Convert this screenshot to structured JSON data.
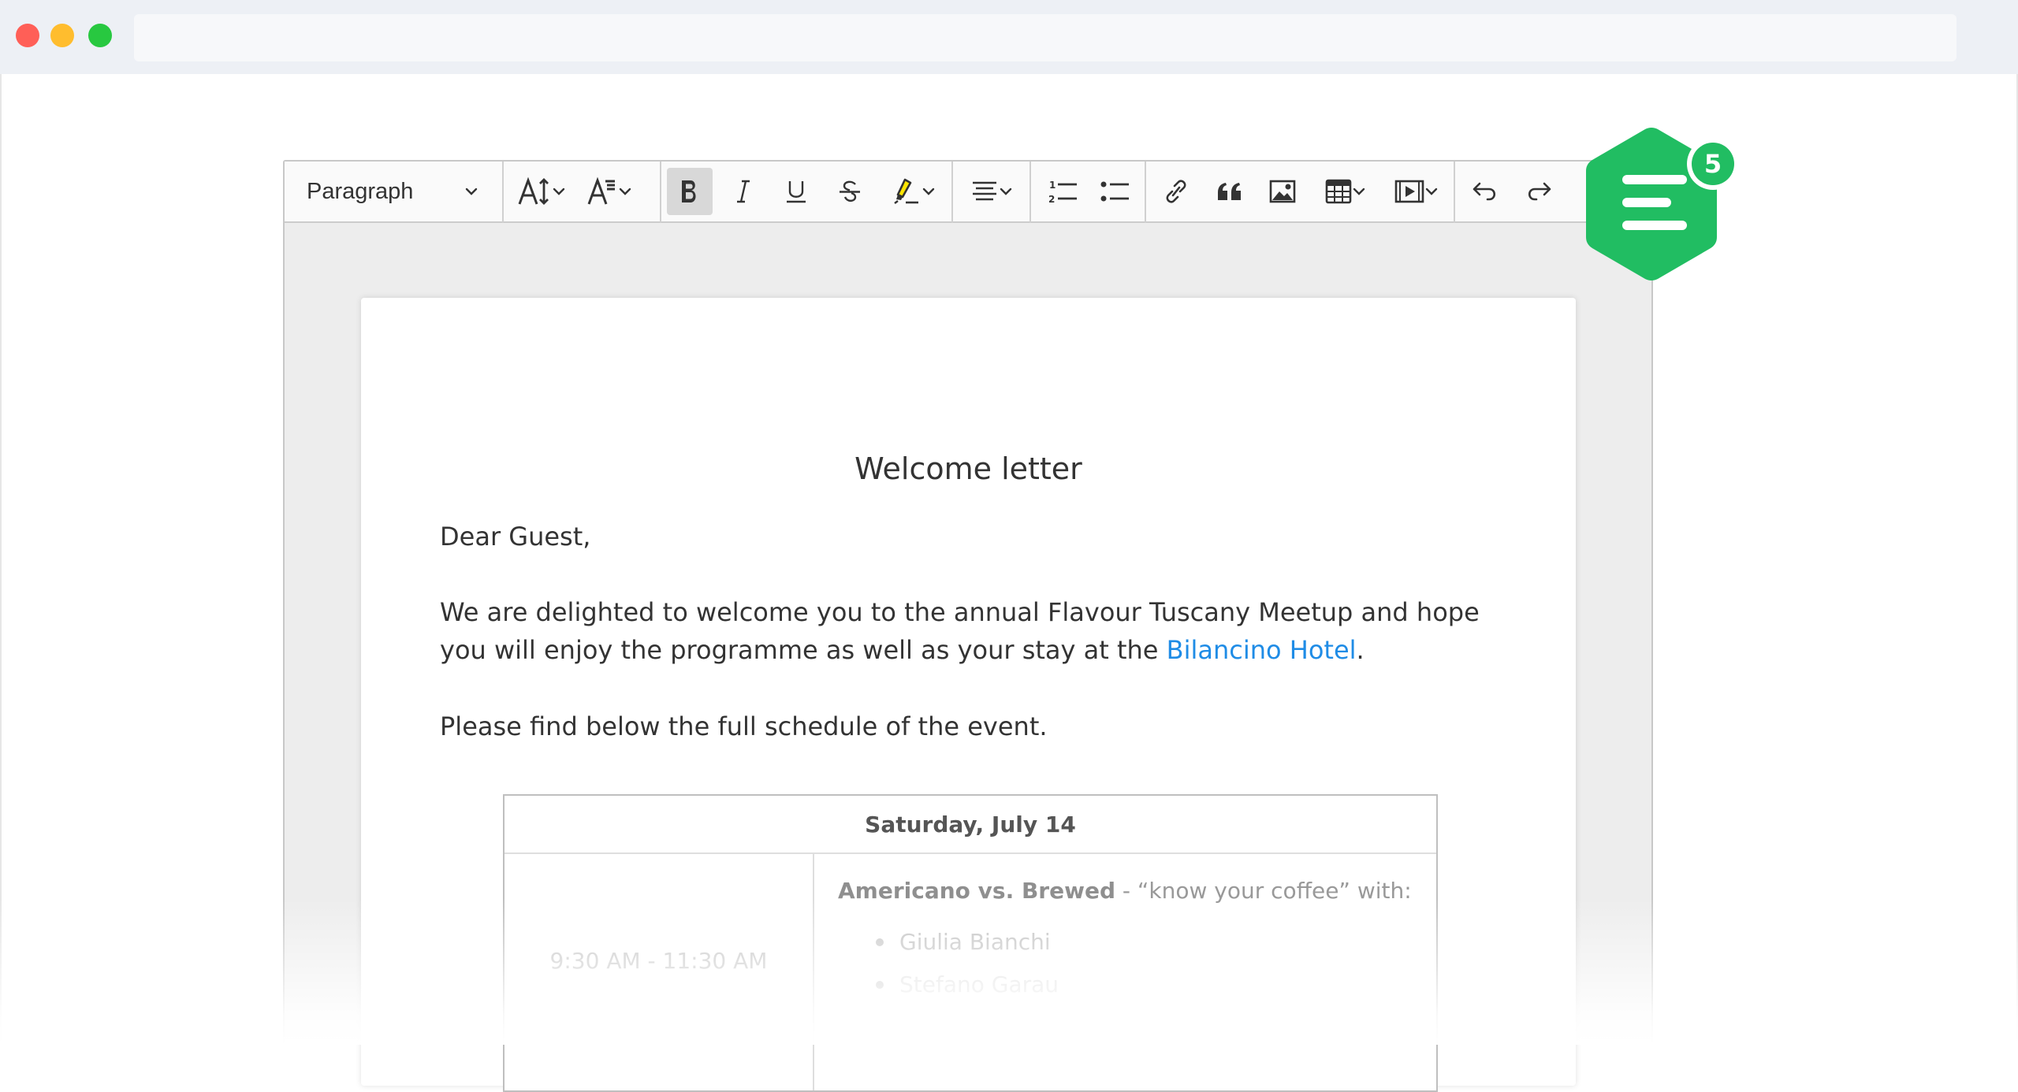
{
  "window": {
    "controls": [
      "close",
      "minimize",
      "maximize"
    ],
    "address_bar": ""
  },
  "toolbar": {
    "heading_select": {
      "value": "Paragraph",
      "icon": "chevron-down-icon"
    },
    "buttons": [
      {
        "name": "font-size",
        "icon": "font-size-icon",
        "dropdown": true
      },
      {
        "name": "font-family",
        "icon": "font-family-icon",
        "dropdown": true
      },
      {
        "name": "bold",
        "icon": "bold-icon",
        "active": true
      },
      {
        "name": "italic",
        "icon": "italic-icon"
      },
      {
        "name": "underline",
        "icon": "underline-icon"
      },
      {
        "name": "strikethrough",
        "icon": "strikethrough-icon"
      },
      {
        "name": "highlight",
        "icon": "highlighter-icon",
        "dropdown": true,
        "color": "#ffe500"
      },
      {
        "name": "alignment",
        "icon": "align-center-icon",
        "dropdown": true
      },
      {
        "name": "numbered-list",
        "icon": "numbered-list-icon"
      },
      {
        "name": "bulleted-list",
        "icon": "bulleted-list-icon"
      },
      {
        "name": "link",
        "icon": "link-icon"
      },
      {
        "name": "block-quote",
        "icon": "quote-icon"
      },
      {
        "name": "insert-image",
        "icon": "image-icon"
      },
      {
        "name": "insert-table",
        "icon": "table-icon",
        "dropdown": true
      },
      {
        "name": "insert-media",
        "icon": "media-icon",
        "dropdown": true
      },
      {
        "name": "undo",
        "icon": "undo-icon"
      },
      {
        "name": "redo",
        "icon": "redo-icon"
      }
    ]
  },
  "annotations_button": {
    "icon": "comments-list-icon",
    "badge_count": "5",
    "color": "#21bd62"
  },
  "document": {
    "title": "Welcome letter",
    "greeting": "Dear Guest,",
    "intro_before_link": "We are delighted to welcome you to the annual Flavour Tuscany Meetup and hope you will enjoy the programme as well as your stay at the ",
    "intro_link": "Bilancino Hotel",
    "intro_after_link": ".",
    "schedule_intro": "Please find below the full schedule of the event.",
    "schedule": {
      "header": "Saturday, July 14",
      "rows": [
        {
          "time": "9:30 AM - 11:30 AM",
          "title": "Americano vs. Brewed",
          "subtitle": " - “know your coffee” with:",
          "people": [
            "Giulia Bianchi",
            "Stefano Garau"
          ]
        }
      ]
    }
  },
  "colors": {
    "link": "#1f8ce6",
    "accent_green": "#21bd62",
    "highlight_yellow": "#ffe500"
  }
}
